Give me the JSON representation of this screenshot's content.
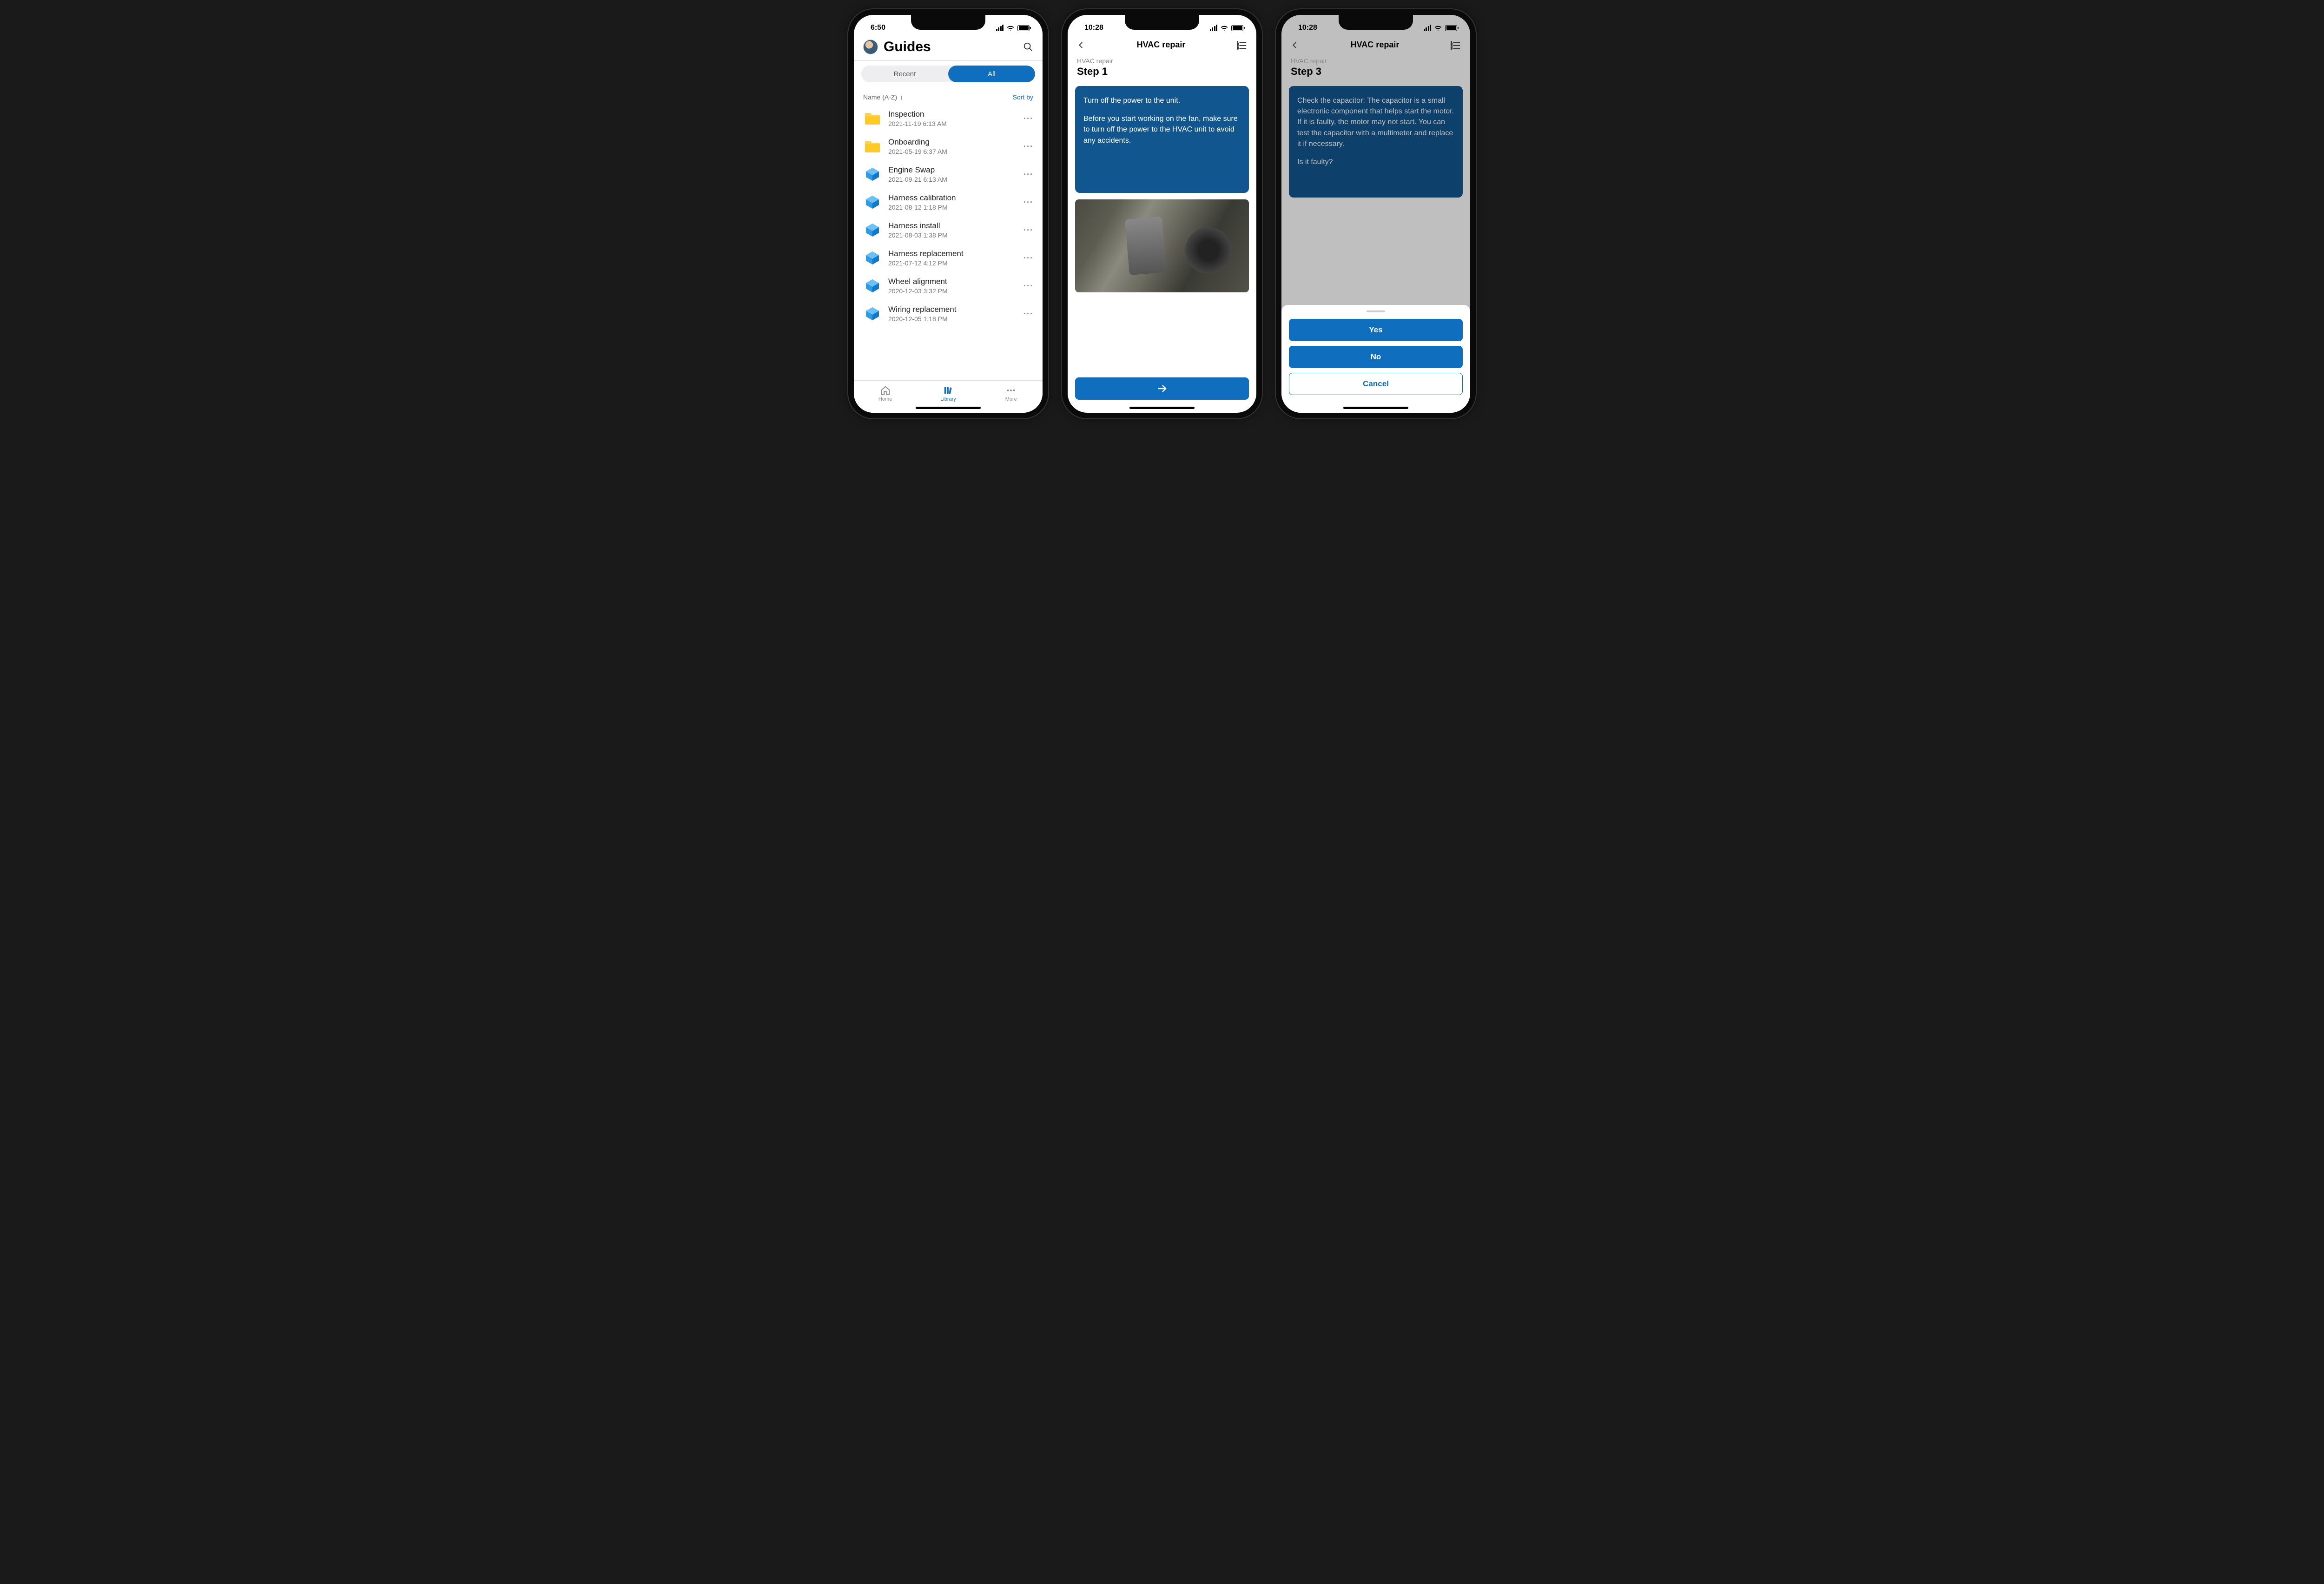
{
  "phone1": {
    "time": "6:50",
    "title": "Guides",
    "tabs": {
      "recent": "Recent",
      "all": "All"
    },
    "sort_label": "Name (A-Z)",
    "sort_by": "Sort by",
    "items": [
      {
        "title": "Inspection",
        "sub": "2021-11-19 6:13 AM",
        "type": "folder"
      },
      {
        "title": "Onboarding",
        "sub": "2021-05-19 6:37 AM",
        "type": "folder"
      },
      {
        "title": "Engine Swap",
        "sub": "2021-09-21 6:13 AM",
        "type": "guide"
      },
      {
        "title": "Harness calibration",
        "sub": "2021-08-12 1:18 PM",
        "type": "guide"
      },
      {
        "title": "Harness install",
        "sub": "2021-08-03 1:38 PM",
        "type": "guide"
      },
      {
        "title": "Harness replacement",
        "sub": "2021-07-12 4:12 PM",
        "type": "guide"
      },
      {
        "title": "Wheel alignment",
        "sub": "2020-12-03 3:32 PM",
        "type": "guide"
      },
      {
        "title": "Wiring replacement",
        "sub": "2020-12-05 1:18 PM",
        "type": "guide"
      }
    ],
    "tabbar": {
      "home": "Home",
      "library": "Library",
      "more": "More"
    }
  },
  "phone2": {
    "time": "10:28",
    "header": "HVAC repair",
    "breadcrumb": "HVAC repair",
    "step": "Step 1",
    "card_p1": "Turn off the power to the unit.",
    "card_p2": "Before you start working on the fan, make sure to turn off the power to the HVAC unit to avoid any accidents."
  },
  "phone3": {
    "time": "10:28",
    "header": "HVAC repair",
    "breadcrumb": "HVAC repair",
    "step": "Step 3",
    "card_p1": "Check the capacitor: The capacitor is a small electronic component that helps start the motor. If it is faulty, the motor may not start. You can test the capacitor with a multimeter and replace it if necessary.",
    "card_p2": "Is it faulty?",
    "sheet": {
      "yes": "Yes",
      "no": "No",
      "cancel": "Cancel"
    }
  }
}
